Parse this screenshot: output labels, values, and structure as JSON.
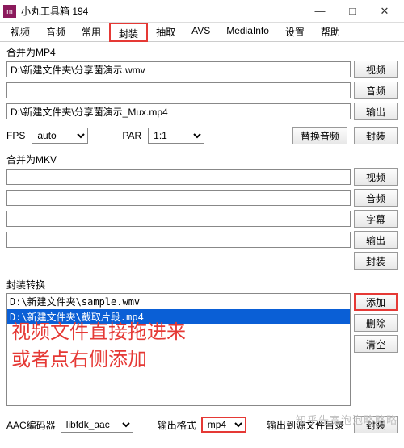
{
  "titlebar": {
    "title": "小丸工具箱 194"
  },
  "tabs": [
    "视频",
    "音频",
    "常用",
    "封装",
    "抽取",
    "AVS",
    "MediaInfo",
    "设置",
    "帮助"
  ],
  "active_tab_index": 3,
  "mp4": {
    "label": "合并为MP4",
    "path1": "D:\\新建文件夹\\分享菌演示.wmv",
    "path2": "",
    "path3": "D:\\新建文件夹\\分享菌演示_Mux.mp4",
    "btn_video": "视频",
    "btn_audio": "音频",
    "btn_output": "输出",
    "fps_label": "FPS",
    "fps_value": "auto",
    "par_label": "PAR",
    "par_value": "1:1",
    "btn_replace": "替换音频",
    "btn_mux": "封装"
  },
  "mkv": {
    "label": "合并为MKV",
    "btn_video": "视频",
    "btn_audio": "音频",
    "btn_sub": "字幕",
    "btn_output": "输出",
    "btn_mux": "封装"
  },
  "conv": {
    "label": "封装转换",
    "items": [
      {
        "text": "D:\\新建文件夹\\sample.wmv",
        "selected": false
      },
      {
        "text": "D:\\新建文件夹\\截取片段.mp4",
        "selected": true
      }
    ],
    "btn_add": "添加",
    "btn_del": "删除",
    "btn_clear": "清空",
    "annotation_l1": "视频文件直接拖进来",
    "annotation_l2": "或者点右侧添加"
  },
  "bottom": {
    "aac_label": "AAC编码器",
    "aac_value": "libfdk_aac",
    "fmt_label": "输出格式",
    "fmt_value": "mp4",
    "out_dir": "输出到源文件目录",
    "btn_mux": "封装"
  },
  "watermark": "知乎先宽泡泡略略略"
}
